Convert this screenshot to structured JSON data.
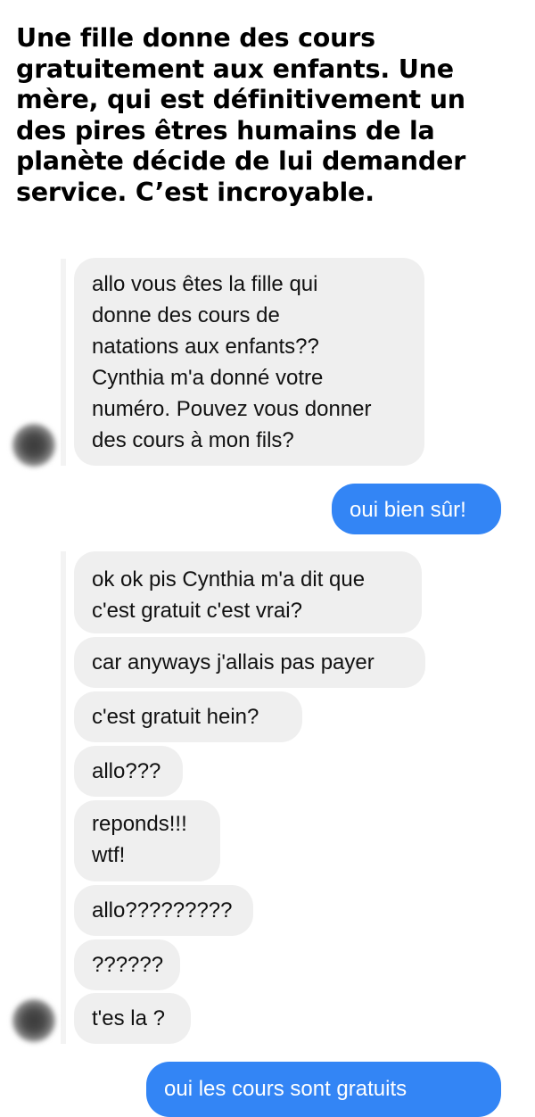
{
  "caption": {
    "lines": [
      "Une fille donne des cours",
      "gratuitement aux enfants. Une",
      "mère, qui est définitivement un",
      "des pires êtres humains de la",
      "planète décide de lui demander",
      "service. C’est incroyable."
    ]
  },
  "messages": [
    {
      "direction": "incoming",
      "lines": [
        "allo vous êtes la fille qui",
        "donne des cours de",
        "natations aux enfants??",
        "Cynthia m'a donné votre",
        "numéro. Pouvez vous donner",
        "des cours à mon fils?"
      ]
    },
    {
      "direction": "outgoing",
      "lines": [
        "oui bien sûr!"
      ]
    },
    {
      "direction": "incoming",
      "lines": [
        "ok ok pis Cynthia m'a dit que",
        "c'est gratuit c'est vrai?"
      ]
    },
    {
      "direction": "incoming",
      "lines": [
        "car anyways j'allais pas payer"
      ]
    },
    {
      "direction": "incoming",
      "lines": [
        "c'est gratuit hein?"
      ]
    },
    {
      "direction": "incoming",
      "lines": [
        "allo???"
      ]
    },
    {
      "direction": "incoming",
      "lines": [
        "reponds!!!",
        "wtf!"
      ]
    },
    {
      "direction": "incoming",
      "lines": [
        "allo?????????"
      ]
    },
    {
      "direction": "incoming",
      "lines": [
        "??????"
      ]
    },
    {
      "direction": "incoming",
      "lines": [
        "t'es la ?"
      ]
    },
    {
      "direction": "outgoing",
      "lines": [
        "oui les cours sont gratuits"
      ]
    }
  ],
  "avatars": [
    {
      "icon": "contact-avatar-icon",
      "blurred": true
    },
    {
      "icon": "contact-avatar-icon",
      "blurred": true
    }
  ],
  "colors": {
    "incoming_bubble": "#efefef",
    "outgoing_bubble": "#3385f5",
    "incoming_text": "#111111",
    "outgoing_text": "#ffffff",
    "caption_text": "#000000"
  }
}
